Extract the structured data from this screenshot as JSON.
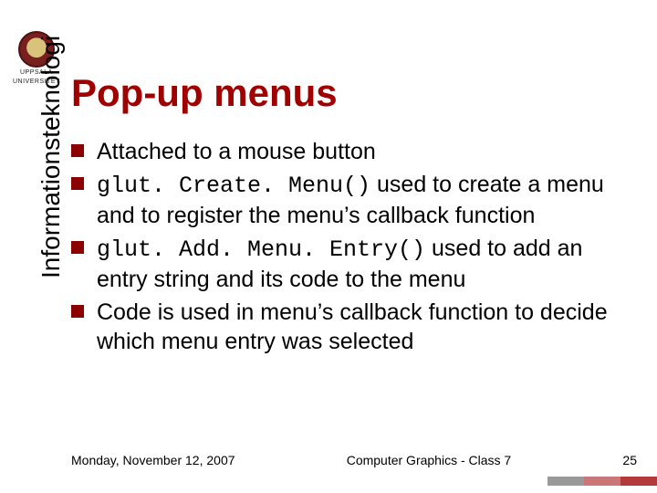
{
  "logo": {
    "line1": "UPPSALA",
    "line2": "UNIVERSITET"
  },
  "title": "Pop-up menus",
  "sidebar_label": "Informationsteknologi",
  "bullets": [
    {
      "segments": [
        {
          "text": "Attached to a mouse button",
          "code": false
        }
      ]
    },
    {
      "segments": [
        {
          "text": "glut. Create. Menu()",
          "code": true
        },
        {
          "text": " used to create a menu and to register the menu’s callback function",
          "code": false
        }
      ]
    },
    {
      "segments": [
        {
          "text": "glut. Add. Menu. Entry()",
          "code": true
        },
        {
          "text": " used to add an entry string and its code to the menu",
          "code": false
        }
      ]
    },
    {
      "segments": [
        {
          "text": "Code is used in menu’s callback function to decide which menu entry was selected",
          "code": false
        }
      ]
    }
  ],
  "footer": {
    "date": "Monday, November 12, 2007",
    "center": "Computer Graphics - Class 7",
    "page": "25"
  }
}
